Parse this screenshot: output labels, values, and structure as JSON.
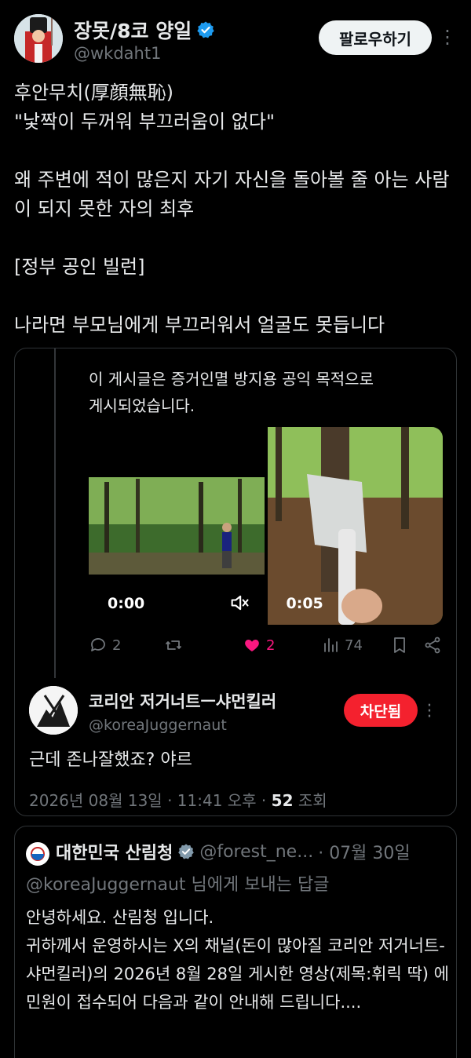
{
  "header": {
    "name": "장못/8코 양일",
    "handle": "@wkdaht1",
    "follow_label": "팔로우하기"
  },
  "tweet": {
    "text": "후안무치(厚顔無恥)\n\"낯짝이 두꺼워 부끄러움이 없다\"\n\n왜 주변에 적이 많은지 자기 자신을 돌아볼 줄 아는 사람이 되지 못한 자의 최후\n\n[정부 공인 빌런]\n\n나라면 부모님에게 부끄러워서 얼굴도 못듭니다"
  },
  "quote": {
    "text": "이 게시글은 증거인멸 방지용 공익 목적으로\n게시되었습니다.",
    "videos": [
      {
        "time": "0:00"
      },
      {
        "time": "0:05"
      }
    ],
    "actions": {
      "replies": "2",
      "reposts": "",
      "likes": "2",
      "views": "74"
    },
    "reply": {
      "name": "코리안 저거너트ㅡ샤먼킬러",
      "handle": "@koreaJuggernaut",
      "blocked_label": "차단됨",
      "text": "근데 존나잘했죠? 야르",
      "date": "2026년 08월 13일 · 11:41 오후 · ",
      "views_count": "52",
      "views_label": " 조회"
    }
  },
  "bottom": {
    "name": "대한민국 산림청",
    "handle": "@forest_ne...",
    "date": "· 07월 30일",
    "reply_to": "@koreaJuggernaut 님에게 보내는 답글",
    "text": "안녕하세요. 산림청 입니다.\n귀하께서 운영하시는 X의 채널(돈이 많아질 코리안 저거너트-샤먼킬러)의 2026년 8월 28일 게시한 영상(제목:휘릭 딱) 에 민원이 접수되어 다음과 같이 안내해 드립니다...."
  },
  "colors": {
    "background": "#000000",
    "text": "#e7e9ea",
    "muted": "#71767b",
    "like": "#f91880",
    "verified": "#1d9bf0",
    "blocked": "#f4212e"
  }
}
